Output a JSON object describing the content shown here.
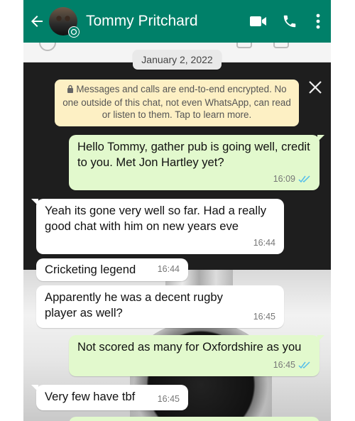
{
  "header": {
    "contact_name": "Tommy Pritchard",
    "bg_color": "#008069"
  },
  "chat": {
    "date_label": "January 2, 2022",
    "encryption_notice": "Messages and calls are end-to-end encrypted. No one outside of this chat, not even WhatsApp, can read or listen to them. Tap to learn more.",
    "messages": [
      {
        "direction": "outgoing",
        "text": "Hello Tommy, gather pub is going well, credit to you. Met Jon Hartley yet?",
        "time": "16:09",
        "status": "read"
      },
      {
        "direction": "incoming",
        "text": "Yeah its gone very well so far. Had a really good chat with him on new years eve",
        "time": "16:44"
      },
      {
        "direction": "incoming",
        "text": "Cricketing legend",
        "time": "16:44"
      },
      {
        "direction": "incoming",
        "text": "Apparently he was a decent rugby player as well?",
        "time": "16:45"
      },
      {
        "direction": "outgoing",
        "text": "Not scored as many for Oxfordshire as you",
        "time": "16:45",
        "status": "read"
      },
      {
        "direction": "incoming",
        "text": "Very few have tbf",
        "time": "16:45"
      }
    ]
  },
  "colors": {
    "outgoing_bubble": "#e2f9cd",
    "incoming_bubble": "#ffffff",
    "read_ticks": "#53bdeb",
    "encryption_notice_bg": "#fdf0c4"
  },
  "icons": {
    "back": "arrow-left-icon",
    "video_call": "video-camera-icon",
    "voice_call": "phone-icon",
    "menu": "vertical-dots-icon",
    "lock": "lock-icon",
    "close": "close-icon",
    "read_receipt": "double-check-icon"
  }
}
